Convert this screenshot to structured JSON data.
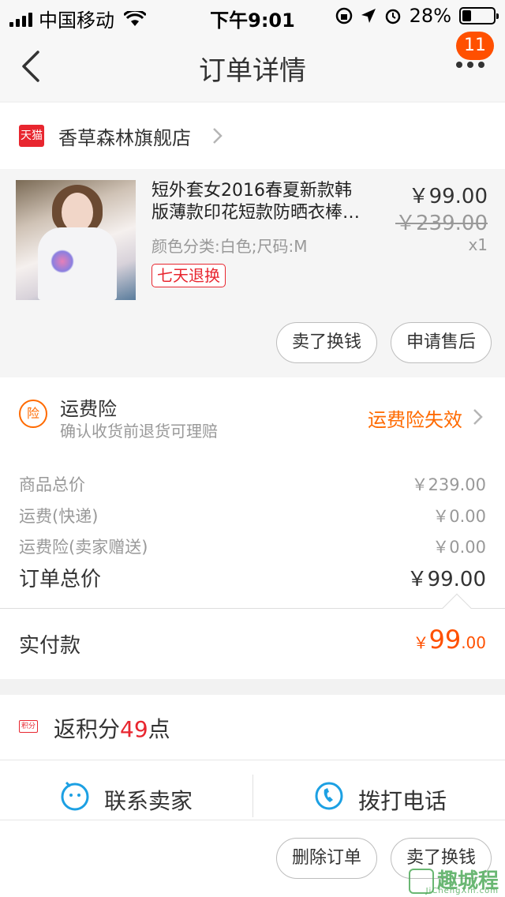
{
  "status_bar": {
    "carrier": "中国移动",
    "time": "下午9:01",
    "battery_text": "28%",
    "battery_level": 0.28
  },
  "nav": {
    "title": "订单详情",
    "badge": "11",
    "back_icon": "chevron-left-icon",
    "more_icon": "more-dots-icon"
  },
  "shop": {
    "badge": "天猫",
    "name": "香草森林旗舰店"
  },
  "product": {
    "title_line1": "短外套女2016春夏新款韩",
    "title_line2": "版薄款印花短款防晒衣棒…",
    "spec": "颜色分类:白色;尺码:M",
    "price": "￥99.00",
    "original_price": "￥239.00",
    "quantity": "x1",
    "return_tag": "七天退换",
    "buttons": {
      "resell": "卖了换钱",
      "after_sale": "申请售后"
    }
  },
  "insurance": {
    "icon_text": "险",
    "title": "运费险",
    "subtitle": "确认收货前退货可理赔",
    "status": "运费险失效"
  },
  "price_rows": [
    {
      "label": "商品总价",
      "value": "￥239.00"
    },
    {
      "label": "运费(快递)",
      "value": "￥0.00"
    },
    {
      "label": "运费险(卖家赠送)",
      "value": "￥0.00"
    },
    {
      "label": "订单总价",
      "value": "￥99.00"
    }
  ],
  "paid": {
    "label": "实付款",
    "currency": "￥",
    "int_part": "99",
    "dec_part": ".00"
  },
  "points": {
    "icon_text": "积分",
    "prefix": "返积分",
    "value": "49",
    "suffix": "点"
  },
  "contact": {
    "seller": "联系卖家",
    "phone": "拨打电话"
  },
  "footer": {
    "delete": "删除订单",
    "resell": "卖了换钱"
  },
  "watermark": {
    "main": "趣城程",
    "sub": "JiChengXin.com"
  },
  "colors": {
    "accent": "#ff5000",
    "tmall_red": "#e8262f",
    "insurance_orange": "#ff6a00"
  }
}
